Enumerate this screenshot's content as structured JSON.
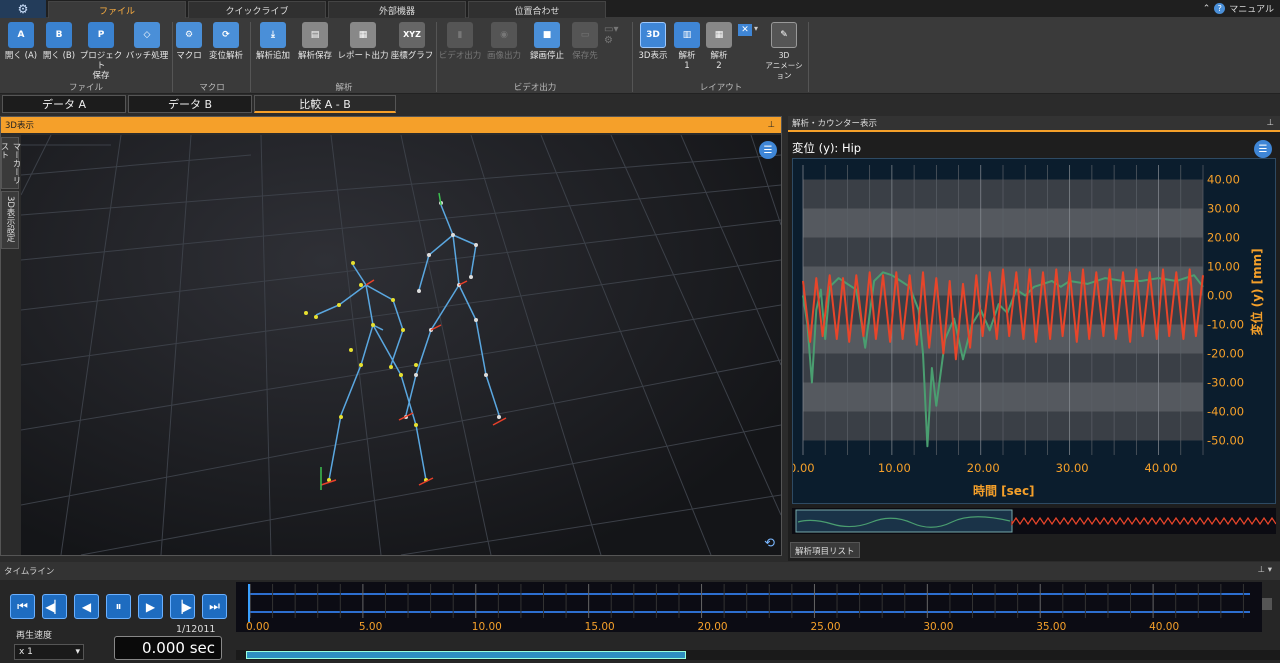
{
  "top_tabs": [
    "ファイル",
    "クイックライブ",
    "外部機器",
    "位置合わせ"
  ],
  "manual_label": "マニュアル",
  "ribbon": {
    "file": [
      {
        "label": "開く (A)",
        "icon": "open-a-icon",
        "glyph": "A"
      },
      {
        "label": "開く (B)",
        "icon": "open-b-icon",
        "glyph": "B"
      },
      {
        "label": "プロジェクト\n保存",
        "icon": "project-save-icon",
        "glyph": "P"
      },
      {
        "label": "バッチ処理",
        "icon": "batch-icon",
        "glyph": "◇"
      }
    ],
    "macro": [
      {
        "label": "マクロ",
        "icon": "macro-icon",
        "glyph": "⚙"
      },
      {
        "label": "変位解析",
        "icon": "displacement-icon",
        "glyph": "⟳"
      }
    ],
    "analysis": [
      {
        "label": "解析追加",
        "icon": "add-analysis-icon",
        "glyph": "⤓"
      },
      {
        "label": "解析保存",
        "icon": "save-analysis-icon",
        "glyph": "▤"
      },
      {
        "label": "レポート出力",
        "icon": "report-icon",
        "glyph": "▦"
      },
      {
        "label": "座標グラフ",
        "icon": "coord-graph-icon",
        "glyph": "XYZ"
      }
    ],
    "video": [
      {
        "label": "ビデオ出力",
        "icon": "video-out-icon",
        "glyph": "▮"
      },
      {
        "label": "画像出力",
        "icon": "image-out-icon",
        "glyph": "◉"
      },
      {
        "label": "録画停止",
        "icon": "record-stop-icon",
        "glyph": "■"
      },
      {
        "label": "保存先",
        "icon": "save-dest-icon",
        "glyph": "▭"
      }
    ],
    "layout": [
      {
        "label": "3D表示",
        "icon": "3d-view-icon",
        "glyph": "3D"
      },
      {
        "label": "解析\n1",
        "icon": "analysis-1-icon",
        "glyph": "▥"
      },
      {
        "label": "解析\n2",
        "icon": "analysis-2-icon",
        "glyph": "▦"
      },
      {
        "label": "3D\nアニメーション",
        "icon": "3d-animation-icon",
        "glyph": "✎"
      }
    ],
    "groups": [
      "ファイル",
      "マクロ",
      "解析",
      "ビデオ出力",
      "レイアウト"
    ]
  },
  "data_tabs": [
    "データ A",
    "データ B",
    "比較 A - B"
  ],
  "view3d": {
    "title": "3D表示",
    "side_tabs": [
      "マーカーリスト",
      "3D表示設定"
    ]
  },
  "analysis_panel": {
    "title": "解析・カウンター表示",
    "graph_title": "変位 (y):  Hip",
    "item_list_tab": "解析項目リスト"
  },
  "chart_data": {
    "type": "line",
    "title": "変位 (y):  Hip",
    "xlabel": "時間 [sec]",
    "ylabel": "変位 (y) [mm]",
    "xlim": [
      0,
      45
    ],
    "ylim": [
      -55,
      45
    ],
    "x_ticks": [
      "0.00",
      "10.00",
      "20.00",
      "30.00",
      "40.00"
    ],
    "y_ticks": [
      "40.00",
      "30.00",
      "20.00",
      "10.00",
      "0.00",
      "-10.00",
      "-20.00",
      "-30.00",
      "-40.00",
      "-50.00"
    ],
    "series": [
      {
        "color": "#e8452a",
        "x": [
          0,
          0.8,
          1.5,
          2.2,
          3,
          3.8,
          4.5,
          5.2,
          6,
          6.8,
          7.5,
          8.2,
          9,
          9.8,
          10.5,
          11.2,
          12,
          12.8,
          13.5,
          14.2,
          15,
          15.8,
          16.5,
          17.2,
          18,
          18.8,
          19.5,
          20.2,
          21,
          21.8,
          22.5,
          23.2,
          24,
          24.8,
          25.5,
          26.2,
          27,
          27.8,
          28.5,
          29.2,
          30,
          30.8,
          31.5,
          32.2,
          33,
          33.8,
          34.5,
          35.2,
          36,
          36.8,
          37.5,
          38.2,
          39,
          39.8,
          40.5,
          41.2,
          42,
          42.8,
          43.5,
          44.2,
          45
        ],
        "y": [
          5,
          -16,
          6,
          -14,
          7,
          -15,
          6,
          -16,
          7,
          -14,
          8,
          -15,
          7,
          -16,
          8,
          -15,
          7,
          -17,
          8,
          -18,
          6,
          -20,
          5,
          -22,
          4,
          -18,
          7,
          -14,
          8,
          -15,
          9,
          -14,
          8,
          -15,
          9,
          -16,
          8,
          -15,
          9,
          -14,
          8,
          -16,
          9,
          -15,
          8,
          -14,
          9,
          -15,
          8,
          -16,
          9,
          -14,
          8,
          -15,
          9,
          -14,
          8,
          -15,
          9,
          -14,
          7
        ]
      },
      {
        "color": "#4a9e70",
        "x": [
          0,
          0.5,
          1,
          1.5,
          2,
          2.5,
          3,
          4,
          5,
          6,
          7,
          8,
          9,
          10,
          11,
          12,
          13,
          13.5,
          14,
          14.5,
          15,
          16,
          17,
          18,
          19,
          20,
          21,
          22,
          23,
          24,
          25,
          26,
          27,
          28,
          29,
          30,
          32,
          34,
          36,
          38,
          40,
          42,
          44,
          45
        ],
        "y": [
          0,
          -10,
          -30,
          -5,
          2,
          -15,
          3,
          6,
          4,
          2,
          -18,
          5,
          8,
          7,
          5,
          3,
          -5,
          -20,
          -52,
          -25,
          -38,
          -15,
          -8,
          -22,
          -10,
          -5,
          -12,
          -3,
          -6,
          2,
          0,
          3,
          4,
          5,
          3,
          5,
          4,
          6,
          5,
          5,
          6,
          5,
          7,
          3
        ]
      }
    ]
  },
  "timeline": {
    "title": "タイムライン",
    "speed_label": "再生速度",
    "speed_value": "x 1",
    "frame_counter": "1/12011",
    "time_value": "0.000 sec",
    "ticks": [
      "0.00",
      "5.00",
      "10.00",
      "15.00",
      "20.00",
      "25.00",
      "30.00",
      "35.00",
      "40.00"
    ]
  }
}
